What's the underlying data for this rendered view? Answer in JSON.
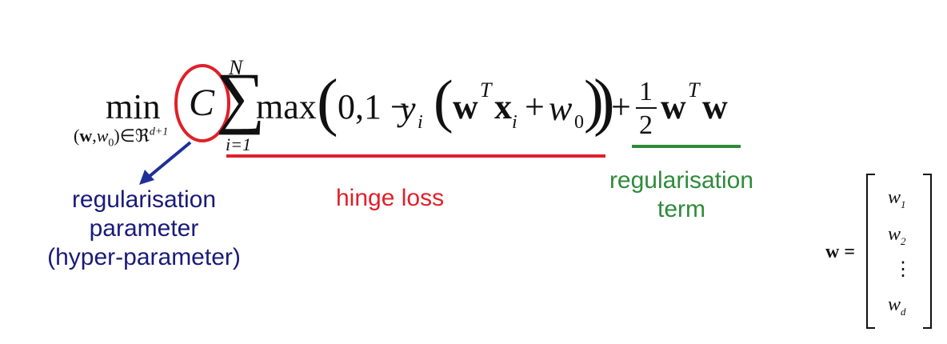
{
  "formula": {
    "min": "min",
    "min_subscript": "(w,w0)∈ℜd+1",
    "min_sub_open": "(",
    "min_sub_w": "w",
    "min_sub_comma": ",",
    "min_sub_w0": "w",
    "min_sub_w0_index": "0",
    "min_sub_close": ")",
    "min_sub_in": "∈ℜ",
    "min_sub_exp": "d+1",
    "C": "C",
    "sum": "∑",
    "sum_upper": "N",
    "sum_lower": "i=1",
    "max": "max",
    "paren_open": "(",
    "zero_one_minus": "0,1 −",
    "y": "y",
    "y_index": "i",
    "inner_open": "(",
    "wT_w": "w",
    "wT_T": "T",
    "x": "x",
    "x_index": "i",
    "plus_w0": "+",
    "w0_w": "w",
    "w0_index": "0",
    "inner_close": ")",
    "paren_close": ")",
    "plus": "+",
    "frac_num": "1",
    "frac_den": "2",
    "reg_w": "w",
    "reg_T": "T",
    "reg_w2": "w"
  },
  "annotations": {
    "regularisation_parameter": {
      "line1": "regularisation",
      "line2": "parameter",
      "line3": "(hyper-parameter)",
      "color": "#1a1a7a"
    },
    "hinge_loss": {
      "text": "hinge loss",
      "color": "#e0202a"
    },
    "regularisation_term": {
      "line1": "regularisation",
      "line2": "term",
      "color": "#2e8b3a"
    }
  },
  "vector": {
    "lhs": "w =",
    "entries": [
      "w",
      "w",
      "⋮",
      "w"
    ],
    "indices": [
      "1",
      "2",
      "",
      "d"
    ]
  },
  "colors": {
    "circle": "#e0202a",
    "arrow": "#1f2f9a",
    "hinge_underline": "#e0202a",
    "reg_underline": "#2e8b3a"
  }
}
